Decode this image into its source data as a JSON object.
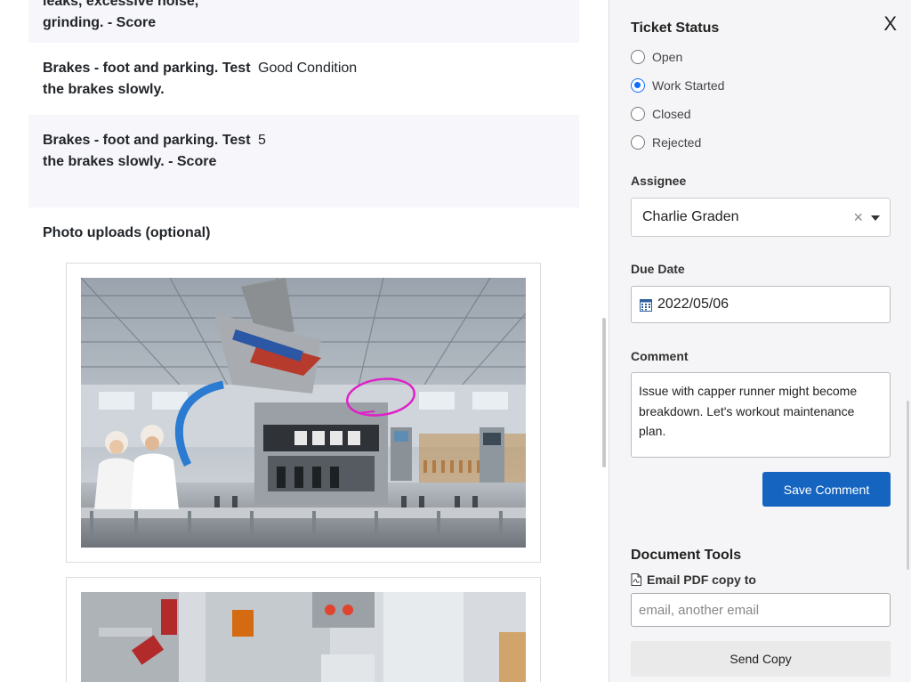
{
  "checklist": {
    "rows": [
      {
        "question": "leaks, excessive noise, grinding. - Score",
        "answer": ""
      },
      {
        "question": "Brakes - foot and parking. Test the brakes slowly.",
        "answer": "Good Condition"
      },
      {
        "question": "Brakes - foot and parking. Test the brakes slowly. - Score",
        "answer": "5"
      }
    ],
    "photos_label": "Photo uploads (optional)"
  },
  "panel": {
    "close_label": "X",
    "ticket_status": {
      "title": "Ticket Status",
      "options": [
        "Open",
        "Work Started",
        "Closed",
        "Rejected"
      ],
      "selected": "Work Started"
    },
    "assignee": {
      "label": "Assignee",
      "value": "Charlie Graden",
      "clear_glyph": "×"
    },
    "due_date": {
      "label": "Due Date",
      "value": "2022/05/06"
    },
    "comment": {
      "label": "Comment",
      "value": "Issue with capper runner might become breakdown. Let's workout maintenance plan."
    },
    "save_button": "Save Comment",
    "document_tools": {
      "title": "Document Tools",
      "email_label": "Email PDF copy to",
      "email_placeholder": "email, another email",
      "send_button": "Send Copy"
    }
  },
  "colors": {
    "accent": "#1565c0",
    "radio_checked": "#0d6efd",
    "annotation": "#e020c8"
  }
}
